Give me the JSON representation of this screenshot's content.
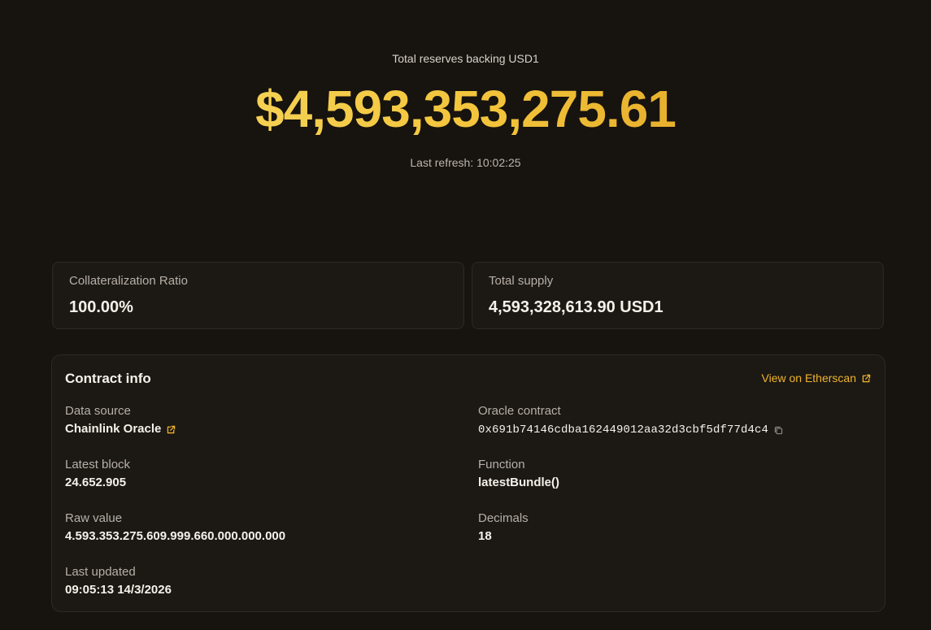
{
  "hero": {
    "label": "Total reserves backing USD1",
    "amount": "$4,593,353,275.61",
    "refresh": "Last refresh: 10:02:25"
  },
  "stats": {
    "collateralization": {
      "label": "Collateralization Ratio",
      "value": "100.00%"
    },
    "supply": {
      "label": "Total supply",
      "value": "4,593,328,613.90 USD1"
    }
  },
  "contract": {
    "title": "Contract info",
    "etherscan_label": "View on Etherscan",
    "fields": {
      "data_source": {
        "label": "Data source",
        "value": "Chainlink Oracle",
        "icon": "external-link-icon"
      },
      "oracle_contract": {
        "label": "Oracle contract",
        "value": "0x691b74146cdba162449012aa32d3cbf5df77d4c4",
        "icon": "copy-icon"
      },
      "latest_block": {
        "label": "Latest block",
        "value": "24.652.905"
      },
      "function": {
        "label": "Function",
        "value": "latestBundle()"
      },
      "raw_value": {
        "label": "Raw value",
        "value": "4.593.353.275.609.999.660.000.000.000"
      },
      "decimals": {
        "label": "Decimals",
        "value": "18"
      },
      "last_updated": {
        "label": "Last updated",
        "value": "09:05:13 14/3/2026"
      }
    }
  },
  "colors": {
    "background": "#17130f",
    "card": "#1c1814",
    "accent": "#efb42d",
    "gold_start": "#f7df6d",
    "gold_end": "#d79519",
    "text": "#f5f1ea",
    "muted_text": "#b7b0a8"
  }
}
